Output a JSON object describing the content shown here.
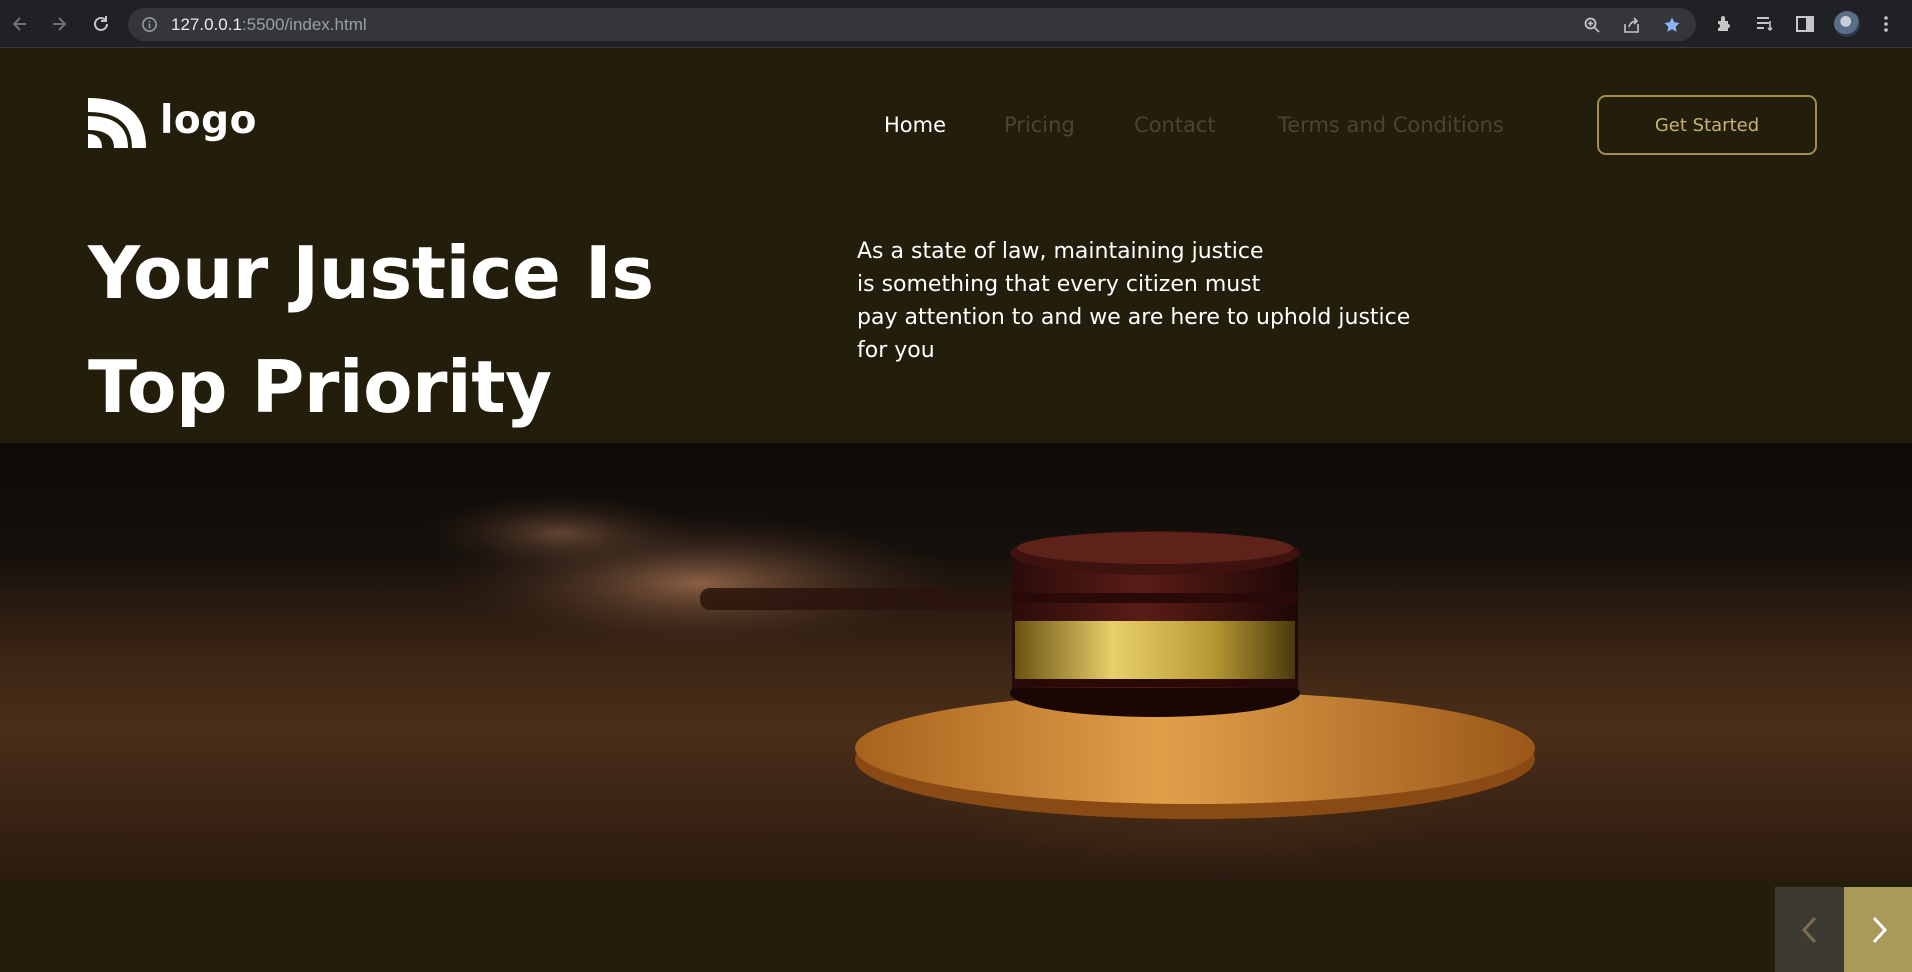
{
  "browser": {
    "url_host": "127.0.0.1",
    "url_rest": ":5500/index.html",
    "icons": [
      "back-icon",
      "forward-icon",
      "reload-icon",
      "info-icon",
      "zoom-icon",
      "share-icon",
      "bookmark-star-icon",
      "extensions-icon",
      "reading-list-icon",
      "side-panel-icon",
      "profile-avatar",
      "menu-kebab-icon"
    ]
  },
  "site": {
    "logo_text": "logo",
    "nav": [
      {
        "label": "Home",
        "active": true
      },
      {
        "label": "Pricing",
        "active": false
      },
      {
        "label": "Contact",
        "active": false
      },
      {
        "label": "Terms and Conditions",
        "active": false
      }
    ],
    "cta_label": "Get Started"
  },
  "hero": {
    "title_line1": "Your Justice Is",
    "title_line2": "Top Priority",
    "text_lines": [
      "As a state of law, maintaining justice",
      "is something that every citizen must",
      "pay attention to and we are here to uphold justice",
      "for you"
    ],
    "image": "gavel-on-sound-block-photo"
  },
  "slider": {
    "prev_icon": "chevron-left-icon",
    "next_icon": "chevron-right-icon"
  },
  "colors": {
    "page_bg": "#231d0b",
    "accent": "#a9995a",
    "nav_inactive": "#4b4434",
    "text": "#ffffff"
  }
}
